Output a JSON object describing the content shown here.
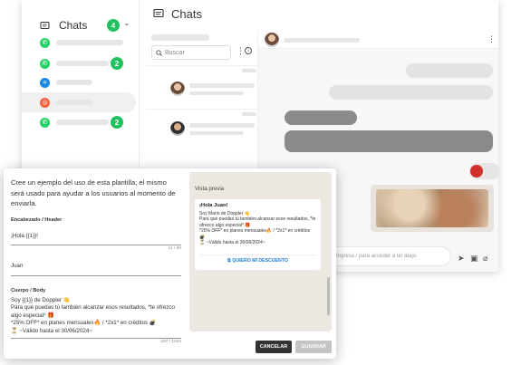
{
  "sidebar": {
    "title": "Chats",
    "unread_total": "4",
    "items": [
      {
        "channel": "whatsapp",
        "badge": ""
      },
      {
        "channel": "whatsapp",
        "badge": "2"
      },
      {
        "channel": "messenger",
        "badge": ""
      },
      {
        "channel": "instagram",
        "badge": ""
      },
      {
        "channel": "whatsapp",
        "badge": "2"
      }
    ]
  },
  "header": {
    "title": "Chats"
  },
  "chat_list": {
    "search_placeholder": "Buscar"
  },
  "composer": {
    "placeholder": "Ingresa / para acceder a un atajo."
  },
  "modal": {
    "intro": "Cree un ejemplo del uso de esta plantilla; el mismo será usado para ayudar a los usuarios al momento de enviarla.",
    "header_label": "Encabezado / Header",
    "header_value": "¡Hola {{1}}!",
    "header_counter": "11 / 60",
    "var_value": "Juan",
    "body_label": "Cuerpo / Body",
    "body_lines": [
      "Soy {{1}} de Doppler 👋",
      "Para que puedas tú también alcanzar esos resultados, *te ofrezco algo especial* 🎁",
      "*25% OFF* en planes mensuales🔥 / *2x1* en créditos 💣",
      "⏳ ~Válido hasta el 30/06/2024~"
    ],
    "body_counter": "197 / 1024",
    "preview": {
      "title": "Vista previa",
      "greeting": "¡Hola Juan!",
      "lines": [
        "Soy Mario de Doppler 👋",
        "Para que puedas tú también alcanzar esos resultados, *te ofrezco algo especial* 🎁",
        "*25% OFF* en planes mensuales🔥 / *2x1* en créditos 💣",
        "⏳ ~Válido hasta el 30/06/2024~"
      ],
      "link": "QUIERO MI DESCUENTO"
    },
    "cancel_label": "CANCELAR",
    "save_label": "GUARDAR"
  },
  "colors": {
    "badge": "#21c25e",
    "link": "#1e7fd6",
    "primary_button": "#333333"
  }
}
